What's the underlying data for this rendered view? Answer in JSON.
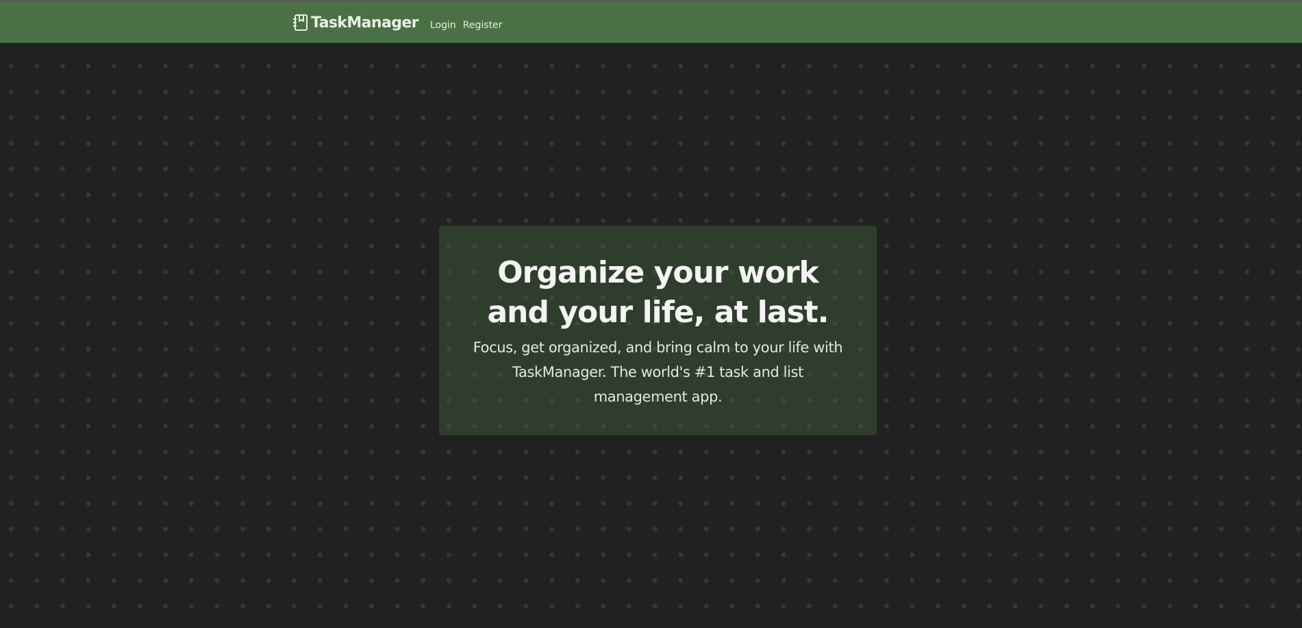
{
  "navbar": {
    "brand": {
      "icon": "journal-icon",
      "name": "TaskManager"
    },
    "links": [
      {
        "label": "Login"
      },
      {
        "label": "Register"
      }
    ]
  },
  "hero": {
    "title": "Organize your work and your life, at last.",
    "subtitle": "Focus, get organized, and bring calm to your life with TaskManager. The world's #1 task and list management app."
  },
  "colors": {
    "navbar_background": "#4a7044",
    "page_background": "#212121",
    "hero_panel": "#2f3b2c",
    "text": "#f2f2f2"
  }
}
